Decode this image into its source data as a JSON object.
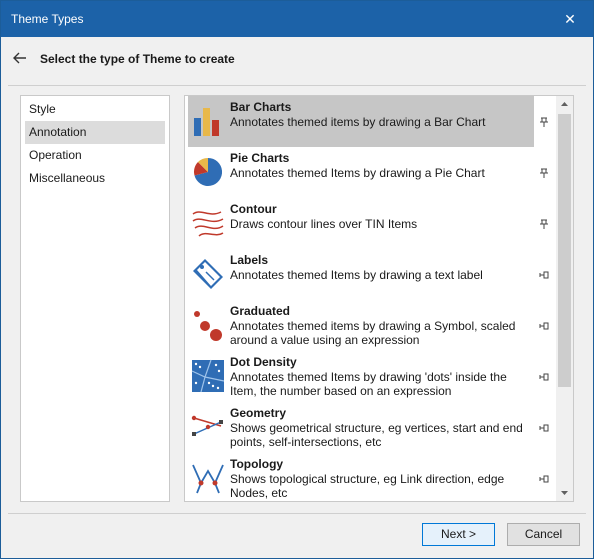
{
  "window": {
    "title": "Theme Types",
    "close_glyph": "✕"
  },
  "header": {
    "heading": "Select the type of Theme to create",
    "back_icon": "arrow-left-icon"
  },
  "categories": [
    {
      "label": "Style",
      "selected": false
    },
    {
      "label": "Annotation",
      "selected": true
    },
    {
      "label": "Operation",
      "selected": false
    },
    {
      "label": "Miscellaneous",
      "selected": false
    }
  ],
  "theme_types": [
    {
      "name": "Bar Charts",
      "description": "Annotates themed items by drawing a Bar Chart",
      "icon": "bar-chart-icon",
      "selected": true
    },
    {
      "name": "Pie Charts",
      "description": "Annotates themed Items by drawing a Pie Chart",
      "icon": "pie-chart-icon",
      "selected": false
    },
    {
      "name": "Contour",
      "description": "Draws contour lines over TIN Items",
      "icon": "contour-icon",
      "selected": false
    },
    {
      "name": "Labels",
      "description": "Annotates themed Items by drawing a text label",
      "icon": "label-tag-icon",
      "selected": false
    },
    {
      "name": "Graduated",
      "description": "Annotates themed items by drawing a Symbol, scaled around a value using an expression",
      "icon": "graduated-symbol-icon",
      "selected": false
    },
    {
      "name": "Dot Density",
      "description": "Annotates themed Items by drawing 'dots' inside the Item, the number based on an expression",
      "icon": "dot-density-icon",
      "selected": false
    },
    {
      "name": "Geometry",
      "description": "Shows geometrical structure, eg vertices, start and end points, self-intersections, etc",
      "icon": "geometry-icon",
      "selected": false
    },
    {
      "name": "Topology",
      "description": "Shows topological structure, eg Link direction, edge Nodes, etc",
      "icon": "topology-icon",
      "selected": false
    }
  ],
  "buttons": {
    "next": "Next >",
    "cancel": "Cancel"
  },
  "colors": {
    "titlebar": "#1c62a8",
    "selection": "#c6c6c6",
    "icon_blue": "#2f6db5",
    "icon_red": "#c0392b",
    "icon_gold": "#e8b84a"
  }
}
